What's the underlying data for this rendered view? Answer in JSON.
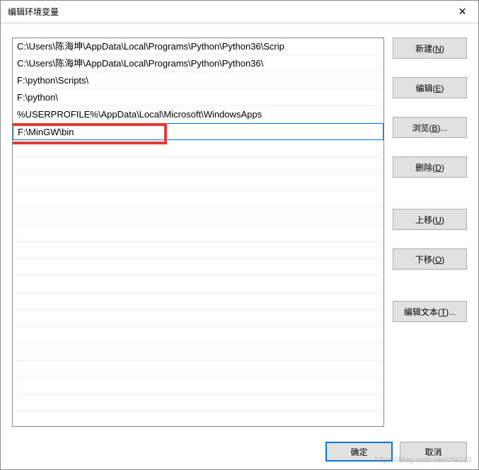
{
  "window": {
    "title": "编辑环境变量"
  },
  "list": {
    "items": [
      "C:\\Users\\陈海坤\\AppData\\Local\\Programs\\Python\\Python36\\Scrip",
      "C:\\Users\\陈海坤\\AppData\\Local\\Programs\\Python\\Python36\\",
      "F:\\python\\Scripts\\",
      "F:\\python\\",
      "%USERPROFILE%\\AppData\\Local\\Microsoft\\WindowsApps",
      "F:\\MinGW\\bin"
    ],
    "editing_index": 5
  },
  "buttons": {
    "new": "新建(N)",
    "edit": "编辑(E)",
    "browse": "浏览(B)...",
    "delete": "删除(D)",
    "moveup": "上移(U)",
    "movedown": "下移(O)",
    "edittext": "编辑文本(T)...",
    "ok": "确定",
    "cancel": "取消"
  },
  "watermark": "https://blog.csdn.net/chk218"
}
